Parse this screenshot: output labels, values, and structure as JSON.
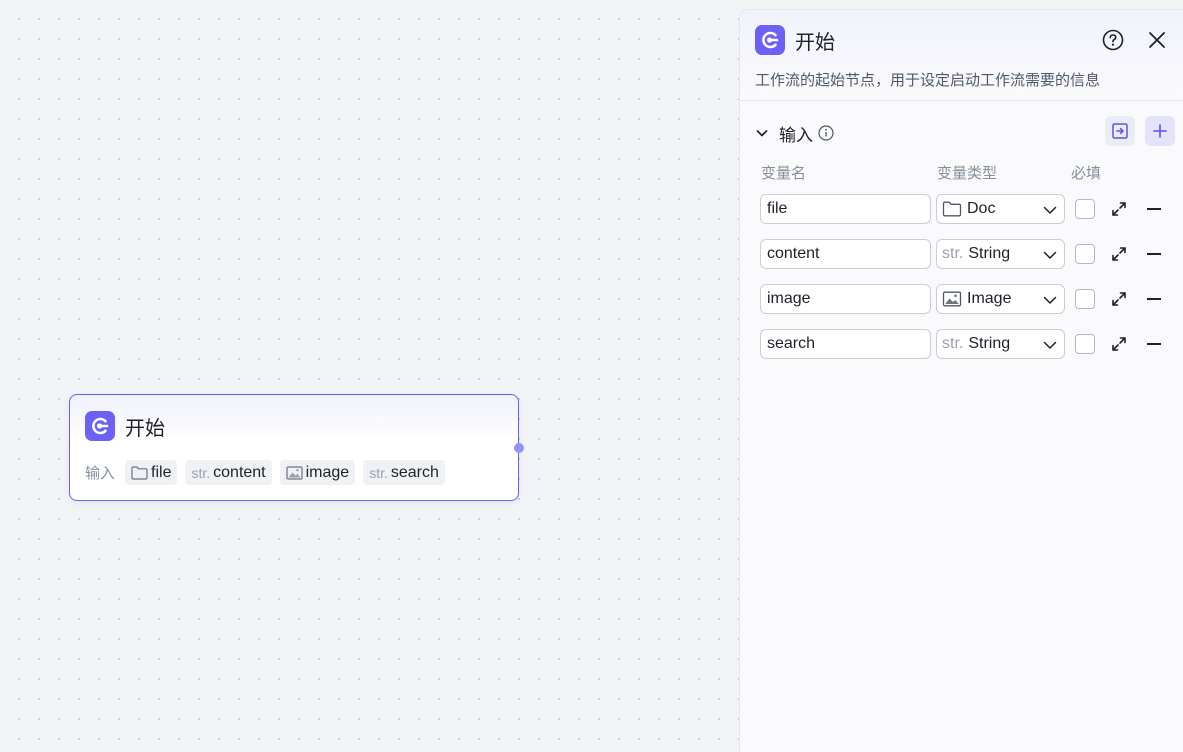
{
  "node": {
    "title": "开始",
    "inputs_label": "输入",
    "inputs": [
      {
        "prefix": "",
        "name": "file",
        "icon": "folder-icon"
      },
      {
        "prefix": "str.",
        "name": "content",
        "icon": "str-icon"
      },
      {
        "prefix": "",
        "name": "image",
        "icon": "image-icon"
      },
      {
        "prefix": "str.",
        "name": "search",
        "icon": "str-icon"
      }
    ]
  },
  "panel": {
    "title": "开始",
    "description": "工作流的起始节点，用于设定启动工作流需要的信息",
    "section_title": "输入",
    "columns": {
      "name": "变量名",
      "type": "变量类型",
      "required": "必填"
    },
    "variables": [
      {
        "name": "file",
        "type_prefix": "",
        "type": "Doc",
        "type_icon": "folder-icon",
        "required": false
      },
      {
        "name": "content",
        "type_prefix": "str.",
        "type": "String",
        "type_icon": "str-icon",
        "required": false
      },
      {
        "name": "image",
        "type_prefix": "",
        "type": "Image",
        "type_icon": "image-icon",
        "required": false
      },
      {
        "name": "search",
        "type_prefix": "str.",
        "type": "String",
        "type_icon": "str-icon",
        "required": false
      }
    ]
  },
  "colors": {
    "accent": "#6d60f5",
    "node_border": "#6b61f0",
    "handle": "#8f95f5"
  }
}
